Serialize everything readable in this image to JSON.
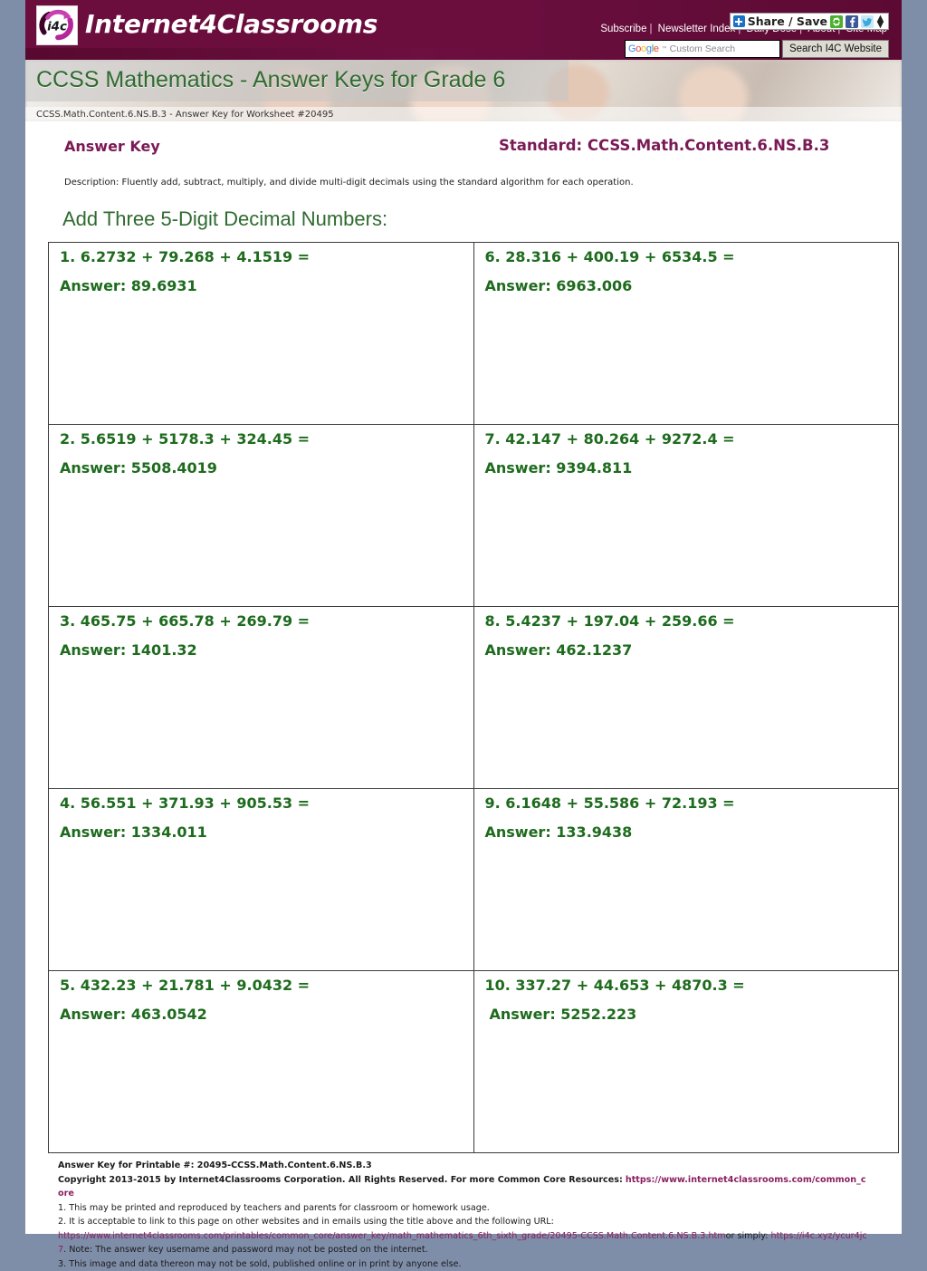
{
  "site": {
    "brand_name": "Internet4Classrooms",
    "logo_text": "i4c",
    "nav": [
      {
        "label": "Subscribe"
      },
      {
        "label": "Newsletter Index"
      },
      {
        "label": "Daily Dose"
      },
      {
        "label": "About"
      },
      {
        "label": "Site Map"
      }
    ],
    "share": {
      "label": "Share / Save",
      "icons": [
        "plus-icon",
        "share-icon",
        "facebook-icon",
        "twitter-icon",
        "updown-arrows-icon"
      ]
    },
    "search": {
      "brand": "Google",
      "tm": "™",
      "placeholder": "Custom Search",
      "value": "",
      "button_label": "Search I4C Website"
    }
  },
  "banner": {
    "title": "CCSS Mathematics - Answer Keys for Grade 6",
    "worksheet_id": "CCSS.Math.Content.6.NS.B.3 - Answer Key for Worksheet #20495"
  },
  "header": {
    "answer_key_label": "Answer Key",
    "standard_label": "Standard: CCSS.Math.Content.6.NS.B.3",
    "description": "Description: Fluently add, subtract, multiply, and divide multi-digit decimals using the standard algorithm for each operation."
  },
  "worksheet": {
    "heading": "Add Three 5-Digit Decimal Numbers:",
    "problems": [
      {
        "question": "1. 6.2732 + 79.268 + 4.1519 =",
        "answer": "Answer: 89.6931"
      },
      {
        "question": "6. 28.316 + 400.19 + 6534.5 =",
        "answer": "Answer: 6963.006"
      },
      {
        "question": "2. 5.6519 + 5178.3 + 324.45 =",
        "answer": "Answer: 5508.4019"
      },
      {
        "question": "7. 42.147 + 80.264 + 9272.4 =",
        "answer": "Answer: 9394.811"
      },
      {
        "question": "3. 465.75 + 665.78 + 269.79 =",
        "answer": "Answer: 1401.32"
      },
      {
        "question": "8. 5.4237 + 197.04 + 259.66 =",
        "answer": "Answer: 462.1237"
      },
      {
        "question": "4. 56.551 + 371.93 + 905.53 =",
        "answer": "Answer: 1334.011"
      },
      {
        "question": "9. 6.1648 + 55.586 + 72.193 =",
        "answer": "Answer: 133.9438"
      },
      {
        "question": "5. 432.23 + 21.781 + 9.0432 =",
        "answer": "Answer: 463.0542"
      },
      {
        "question": "10. 337.27 + 44.653 + 4870.3 =",
        "answer": "Answer: 5252.223"
      }
    ]
  },
  "footer": {
    "printable_line": "Answer Key for Printable #: 20495-CCSS.Math.Content.6.NS.B.3",
    "copyright_text": "Copyright 2013-2015 by Internet4Classrooms Corporation. All Rights Reserved. For more Common Core Resources:",
    "copyright_link": "https://www.internet4classrooms.com/common_core",
    "note1": "1. This may be printed and reproduced by teachers and parents for classroom or homework usage.",
    "note2": "2. It is acceptable to link to this page on other websites and in emails using the title above and the following URL:",
    "note2_url": "https://www.internet4classrooms.com/printables/common_core/answer_key/math_mathematics_6th_sixth_grade/20495-CCSS.Math.Content.6.NS.B.3.htm",
    "note2_mid": "or simply:",
    "note2_short_url": "https://i4c.xyz/ycur4jc7",
    "note2_tail": ". Note: The answer key username and password may not be posted on the internet.",
    "note3": "3. This image and data thereon may not be sold, published online or in print by anyone else."
  },
  "colors": {
    "brand_maroon": "#6b0e3e",
    "heading_green": "#2f6b2f",
    "problem_green": "#1e6b1e",
    "accent_purple": "#7a1a55",
    "link_purple": "#8a2060",
    "page_background": "#7f8ea8"
  }
}
